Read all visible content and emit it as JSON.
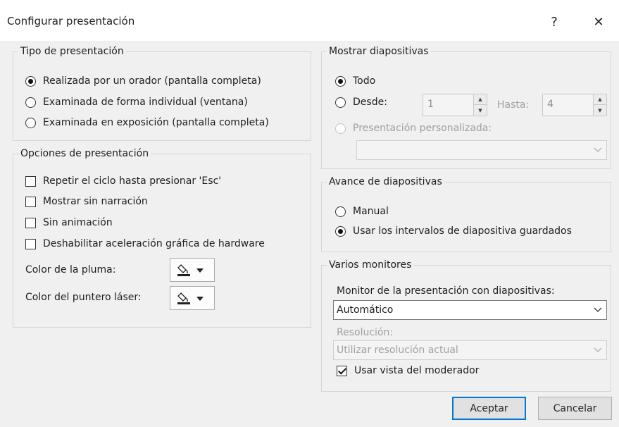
{
  "window": {
    "title": "Configurar presentación",
    "help_glyph": "?",
    "close_glyph": "✕"
  },
  "tipo": {
    "legend": "Tipo de presentación",
    "options": [
      {
        "label": "Realizada por un orador (pantalla completa)",
        "checked": true
      },
      {
        "label": "Examinada de forma individual (ventana)",
        "checked": false
      },
      {
        "label": "Examinada en exposición (pantalla completa)",
        "checked": false
      }
    ]
  },
  "opciones": {
    "legend": "Opciones de presentación",
    "checks": [
      {
        "label": "Repetir el ciclo hasta presionar 'Esc'",
        "checked": false
      },
      {
        "label": "Mostrar sin narración",
        "checked": false
      },
      {
        "label": "Sin animación",
        "checked": false
      },
      {
        "label": "Deshabilitar aceleración gráfica de hardware",
        "checked": false
      }
    ],
    "pen_color_label": "Color de la pluma:",
    "laser_color_label": "Color del puntero láser:"
  },
  "mostrar": {
    "legend": "Mostrar diapositivas",
    "todo": "Todo",
    "desde": "Desde:",
    "desde_value": "1",
    "hasta": "Hasta:",
    "hasta_value": "4",
    "personalizada": "Presentación personalizada:",
    "personalizada_value": ""
  },
  "avance": {
    "legend": "Avance de diapositivas",
    "manual": "Manual",
    "intervalos": "Usar los intervalos de diapositiva guardados"
  },
  "monitores": {
    "legend": "Varios monitores",
    "monitor_label": "Monitor de la presentación con diapositivas:",
    "monitor_value": "Automático",
    "resolucion_label": "Resolución:",
    "resolucion_value": "Utilizar resolución actual",
    "moderador": "Usar vista del moderador",
    "moderador_checked": true
  },
  "buttons": {
    "ok": "Aceptar",
    "cancel": "Cancelar"
  }
}
